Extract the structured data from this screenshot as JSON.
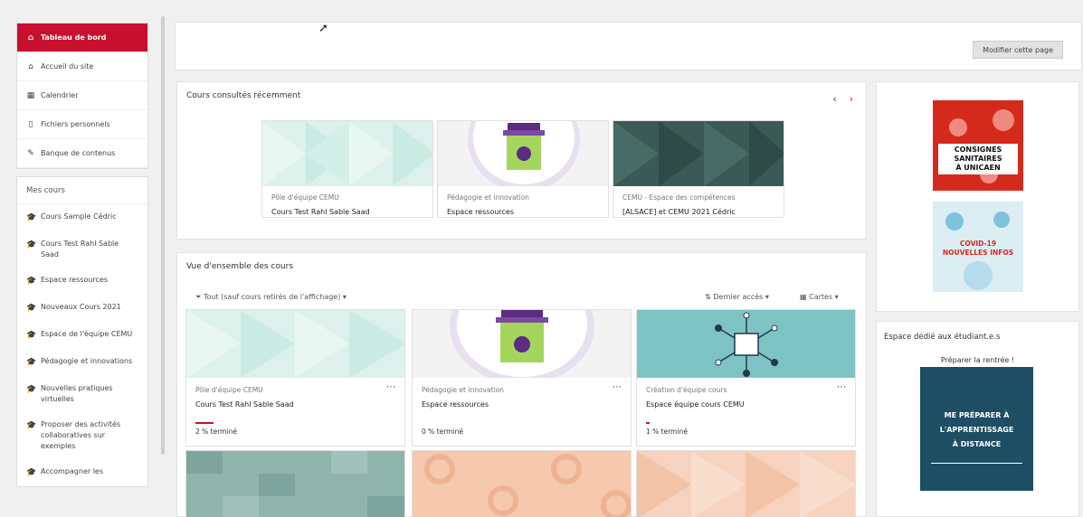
{
  "nav": {
    "items": [
      {
        "label": "Tableau de bord",
        "icon": "dashboard-icon",
        "active": true
      },
      {
        "label": "Accueil du site",
        "icon": "home-icon"
      },
      {
        "label": "Calendrier",
        "icon": "calendar-icon"
      },
      {
        "label": "Fichiers personnels",
        "icon": "file-icon"
      },
      {
        "label": "Banque de contenus",
        "icon": "pen-icon"
      }
    ],
    "section_label": "Mes cours",
    "courses": [
      {
        "label": "Cours Sample Cédric",
        "icon": "graduation-cap-icon"
      },
      {
        "label": "Cours Test Rahl Sable Saad",
        "icon": "graduation-cap-icon"
      },
      {
        "label": "Espace ressources",
        "icon": "graduation-cap-icon"
      },
      {
        "label": "Nouveaux Cours 2021",
        "icon": "graduation-cap-icon"
      },
      {
        "label": "Espace de l'équipe CEMU",
        "icon": "graduation-cap-icon"
      },
      {
        "label": "Pédagogie et innovations",
        "icon": "graduation-cap-icon"
      },
      {
        "label": "Nouvelles pratiques virtuelles",
        "icon": "graduation-cap-icon"
      },
      {
        "label": "Proposer des activités collaboratives sur exemples",
        "icon": "graduation-cap-icon"
      },
      {
        "label": "Accompagner les",
        "icon": "graduation-cap-icon"
      }
    ]
  },
  "header": {
    "edit_button": "Modifier cette page"
  },
  "recent": {
    "title": "Cours consultés récemment",
    "cards": [
      {
        "category": "Pôle d'équipe CEMU",
        "name": "Cours Test Rahl Sable Saad"
      },
      {
        "category": "Pédagogie et innovation",
        "name": "Espace ressources"
      },
      {
        "category": "CEMU - Espace des compétences",
        "name": "[ALSACE] et CEMU 2021 Cédric"
      }
    ]
  },
  "overview": {
    "title": "Vue d'ensemble des cours",
    "filter": "Tout (sauf cours retirés de l'affichage)",
    "sort": "Dernier accès",
    "view": "Cartes",
    "cards": [
      {
        "category": "Pôle d'équipe CEMU",
        "name": "Cours Test Rahl Sable Saad",
        "progress": "2 % terminé",
        "fill": 0.12
      },
      {
        "category": "Pédagogie et innovation",
        "name": "Espace ressources",
        "progress": "0 % terminé",
        "fill": 0
      },
      {
        "category": "Création d'équipe cours",
        "name": "Espace équipe cours CEMU",
        "progress": "1 % terminé",
        "fill": 0.02
      }
    ]
  },
  "side": {
    "banner1": {
      "lines": [
        "CONSIGNES",
        "SANITAIRES",
        "À UNICAEN"
      ]
    },
    "banner2": {
      "lines": [
        "COVID-19",
        "NOUVELLES INFOS"
      ]
    },
    "students_title": "Espace dédié aux étudiant.e.s",
    "students_sub": "Préparer la rentrée !",
    "banner3": {
      "lines": [
        "ME PRÉPARER À",
        "L'APPRENTISSAGE",
        "À DISTANCE"
      ]
    }
  },
  "colors": {
    "accent": "#c8102e",
    "mint": "#dcf1ec",
    "teal": "#7ec3c3",
    "dark_teal": "#3b5a55",
    "peach": "#f6c8ae",
    "purple": "#5b2c82",
    "lime": "#a4d65e",
    "navy": "#1d4e63"
  }
}
